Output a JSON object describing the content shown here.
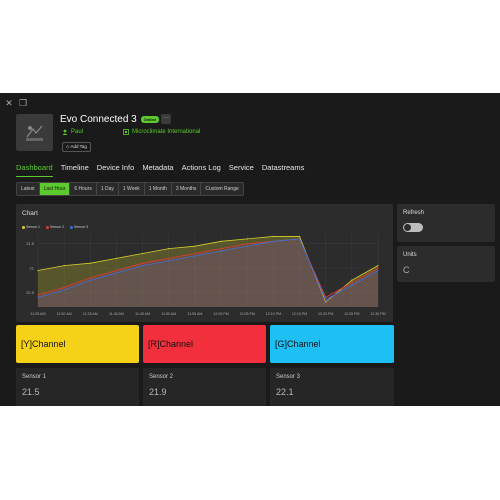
{
  "window": {
    "close_icon": "close-icon",
    "restore_icon": "restore-icon"
  },
  "device": {
    "name": "Evo Connected 3",
    "status": "Online",
    "owner": "Paul",
    "organization": "Microclimate International",
    "add_tag": "Add Tag",
    "more": "···"
  },
  "tabs": [
    "Dashboard",
    "Timeline",
    "Device Info",
    "Metadata",
    "Actions Log",
    "Service",
    "Datastreams"
  ],
  "active_tab": "Dashboard",
  "ranges": [
    "Latest",
    "Last Hour",
    "6 Hours",
    "1 Day",
    "1 Week",
    "1 Month",
    "3 Months",
    "Custom Range"
  ],
  "active_range": "Last Hour",
  "chart_panel": {
    "title": "Chart"
  },
  "refresh": {
    "label": "Refresh",
    "enabled": false
  },
  "units": {
    "label": "Units",
    "value": "C"
  },
  "channels": [
    {
      "label": "[Y]Channel",
      "color": "#f5d117"
    },
    {
      "label": "[R]Channel",
      "color": "#f2303d"
    },
    {
      "label": "[G]Channel",
      "color": "#1ebff2"
    }
  ],
  "sensors": [
    {
      "label": "Sensor 1",
      "value": "21.5"
    },
    {
      "label": "Sensor 2",
      "value": "21.9"
    },
    {
      "label": "Sensor 3",
      "value": "22.1"
    }
  ],
  "colors": {
    "accent": "#5cc92d",
    "sensor1": "#d6cf2a",
    "sensor2": "#e03a3a",
    "sensor3": "#3a6fe0"
  },
  "chart_data": {
    "type": "line",
    "title": "",
    "x": [
      "11:25 AM",
      "11:30 AM",
      "11:35 AM",
      "11:40 AM",
      "11:45 AM",
      "11:50 AM",
      "11:55 AM",
      "12:00 PM",
      "12:05 PM",
      "12:10 PM",
      "12:15 PM",
      "12:20 PM",
      "12:25 PM",
      "12:30 PM"
    ],
    "yticks": [
      "21.5",
      "21",
      "20.5"
    ],
    "ylim": [
      20.2,
      21.7
    ],
    "series": [
      {
        "name": "Sensor 1",
        "values": [
          20.95,
          21.05,
          21.1,
          21.2,
          21.3,
          21.4,
          21.45,
          21.55,
          21.6,
          21.65,
          21.65,
          20.3,
          20.75,
          21.05
        ]
      },
      {
        "name": "Sensor 2",
        "values": [
          20.45,
          20.6,
          20.8,
          20.95,
          21.1,
          21.2,
          21.3,
          21.4,
          21.5,
          21.55,
          21.6,
          20.4,
          20.7,
          21.0
        ]
      },
      {
        "name": "Sensor 3",
        "values": [
          20.4,
          20.55,
          20.75,
          20.9,
          21.05,
          21.15,
          21.25,
          21.35,
          21.45,
          21.55,
          21.6,
          20.35,
          20.65,
          20.95
        ]
      }
    ],
    "grid": true,
    "legend": "top-left"
  }
}
